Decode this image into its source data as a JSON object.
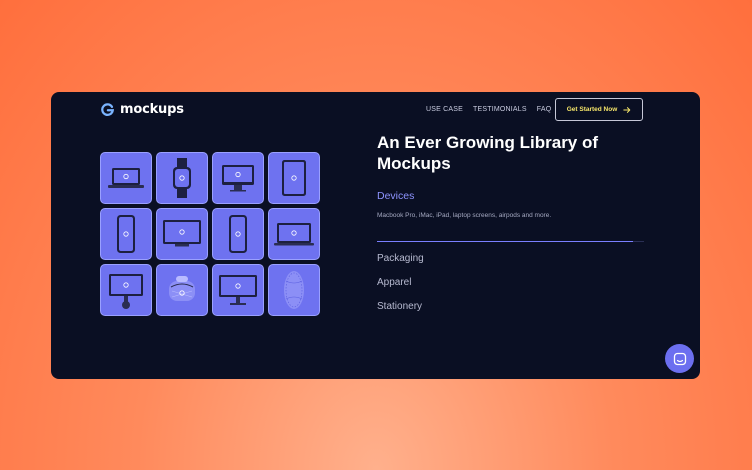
{
  "brand": {
    "name": "mockups",
    "logo_icon": "g-logo-icon"
  },
  "nav": {
    "items": [
      "USE CASE",
      "TESTIMONIALS",
      "FAQ"
    ],
    "cta_label": "Get Started Now",
    "cta_icon": "arrow-right-icon"
  },
  "hero": {
    "headline": "An Ever Growing Library of Mockups"
  },
  "categories": {
    "active": {
      "label": "Devices",
      "description": "Macbook Pro, iMac, iPad, laptop screens, airpods and more.",
      "progress": 0.96
    },
    "others": [
      "Packaging",
      "Apparel",
      "Stationery"
    ]
  },
  "mockup_grid": {
    "tiles": [
      "macbook",
      "smartwatch",
      "imac",
      "ipad",
      "iphone",
      "monitor",
      "iphone-frame",
      "laptop",
      "imac-stand",
      "airpods-case",
      "display",
      "mouse"
    ]
  },
  "chat_widget": {
    "icon": "chat-icon"
  },
  "colors": {
    "accent": "#6e72f0",
    "card_bg": "#0a0f23",
    "cta_text": "#f6e66a",
    "background": "#ff7a48"
  }
}
